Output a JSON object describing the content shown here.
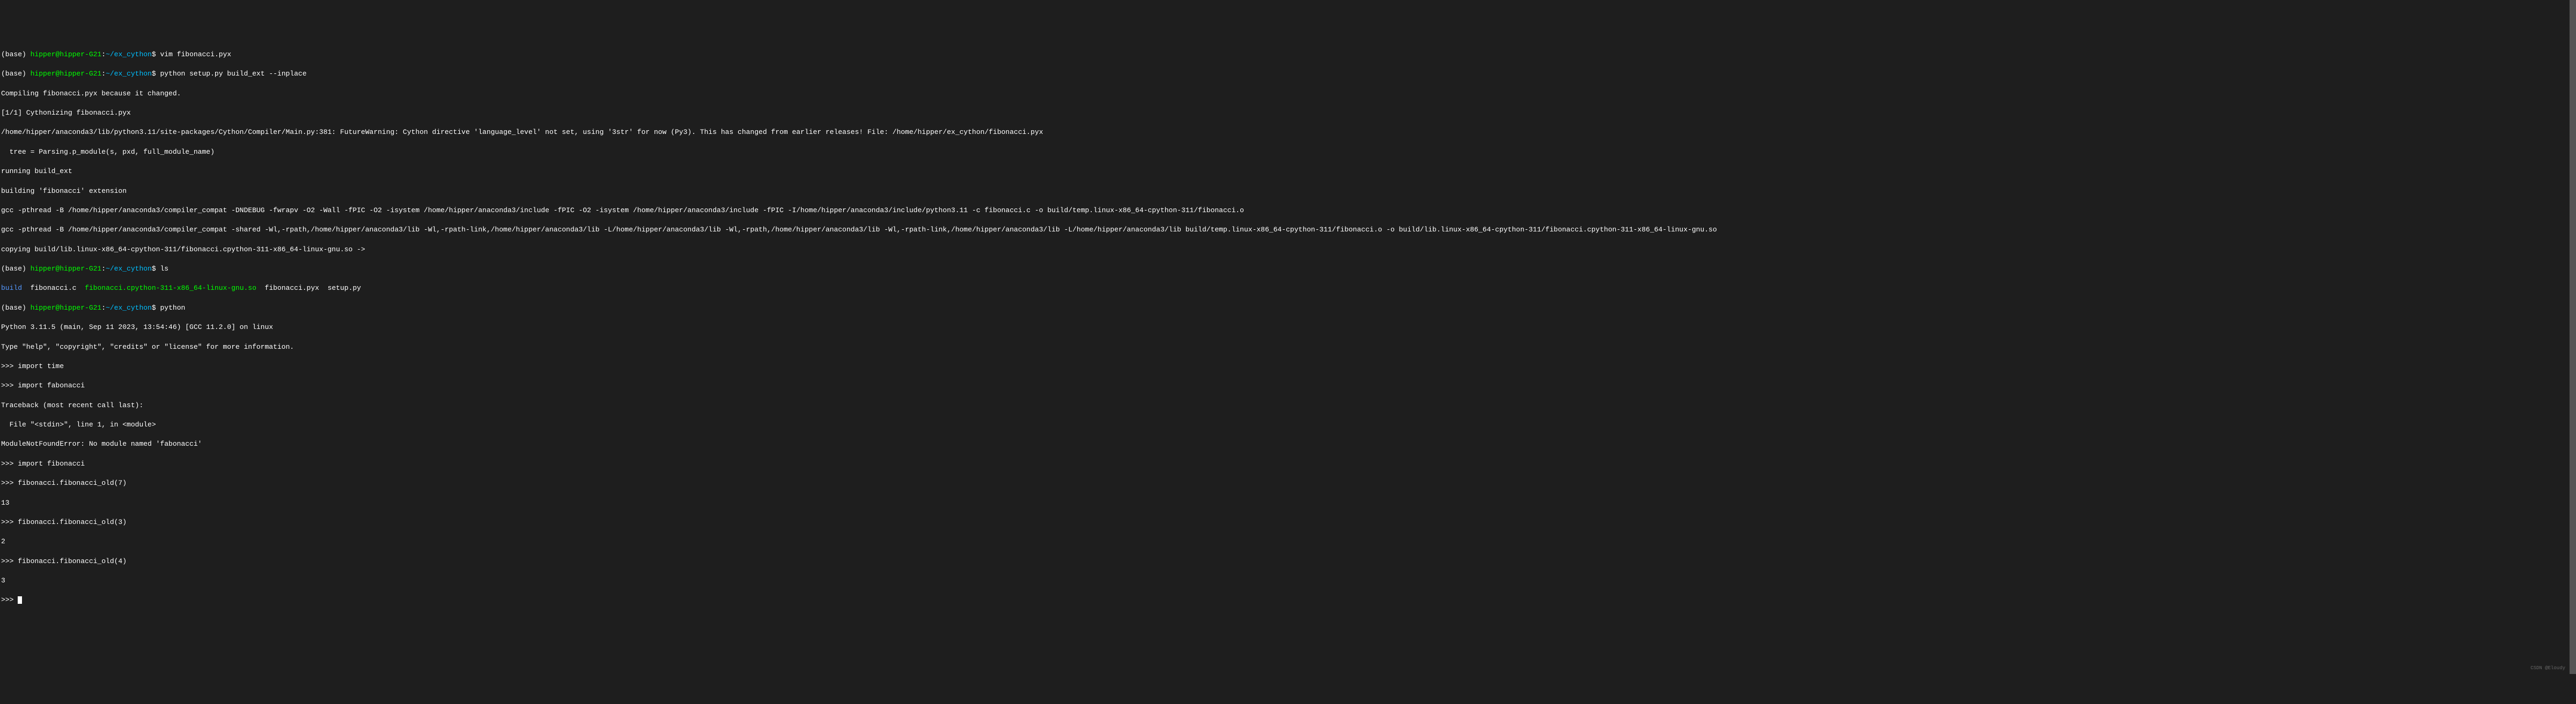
{
  "prompts": {
    "base": "(base) ",
    "user": "hipper@hipper-G21",
    "colon": ":",
    "path": "~/ex_cython",
    "dollar": "$ "
  },
  "commands": {
    "cmd1": "vim fibonacci.pyx",
    "cmd2": "python setup.py build_ext --inplace",
    "cmd3": "ls",
    "cmd4": "python"
  },
  "output": {
    "compile1": "Compiling fibonacci.pyx because it changed.",
    "compile2": "[1/1] Cythonizing fibonacci.pyx",
    "warning1": "/home/hipper/anaconda3/lib/python3.11/site-packages/Cython/Compiler/Main.py:381: FutureWarning: Cython directive 'language_level' not set, using '3str' for now (Py3). This has changed from earlier releases! File: /home/hipper/ex_cython/fibonacci.pyx",
    "warning2": "  tree = Parsing.p_module(s, pxd, full_module_name)",
    "build1": "running build_ext",
    "build2": "building 'fibonacci' extension",
    "gcc1": "gcc -pthread -B /home/hipper/anaconda3/compiler_compat -DNDEBUG -fwrapv -O2 -Wall -fPIC -O2 -isystem /home/hipper/anaconda3/include -fPIC -O2 -isystem /home/hipper/anaconda3/include -fPIC -I/home/hipper/anaconda3/include/python3.11 -c fibonacci.c -o build/temp.linux-x86_64-cpython-311/fibonacci.o",
    "gcc2": "gcc -pthread -B /home/hipper/anaconda3/compiler_compat -shared -Wl,-rpath,/home/hipper/anaconda3/lib -Wl,-rpath-link,/home/hipper/anaconda3/lib -L/home/hipper/anaconda3/lib -Wl,-rpath,/home/hipper/anaconda3/lib -Wl,-rpath-link,/home/hipper/anaconda3/lib -L/home/hipper/anaconda3/lib build/temp.linux-x86_64-cpython-311/fibonacci.o -o build/lib.linux-x86_64-cpython-311/fibonacci.cpython-311-x86_64-linux-gnu.so",
    "copy1": "copying build/lib.linux-x86_64-cpython-311/fibonacci.cpython-311-x86_64-linux-gnu.so -> "
  },
  "ls": {
    "build": "build",
    "sep1": "  ",
    "fibc": "fibonacci.c",
    "sep2": "  ",
    "sofile": "fibonacci.cpython-311-x86_64-linux-gnu.so",
    "sep3": "  ",
    "pyx": "fibonacci.pyx",
    "sep4": "  ",
    "setup": "setup.py"
  },
  "python": {
    "version": "Python 3.11.5 (main, Sep 11 2023, 13:54:46) [GCC 11.2.0] on linux",
    "help": "Type \"help\", \"copyright\", \"credits\" or \"license\" for more information.",
    "repl1": ">>> import time",
    "repl2": ">>> import fabonacci",
    "trace1": "Traceback (most recent call last):",
    "trace2": "  File \"<stdin>\", line 1, in <module>",
    "trace3": "ModuleNotFoundError: No module named 'fabonacci'",
    "repl3": ">>> import fibonacci",
    "repl4": ">>> fibonacci.fibonacci_old(7)",
    "res4": "13",
    "repl5": ">>> fibonacci.fibonacci_old(3)",
    "res5": "2",
    "repl6": ">>> fibonacci.fibonacci_old(4)",
    "res6": "3",
    "repl7": ">>> "
  },
  "watermark": "CSDN @Eloudy"
}
